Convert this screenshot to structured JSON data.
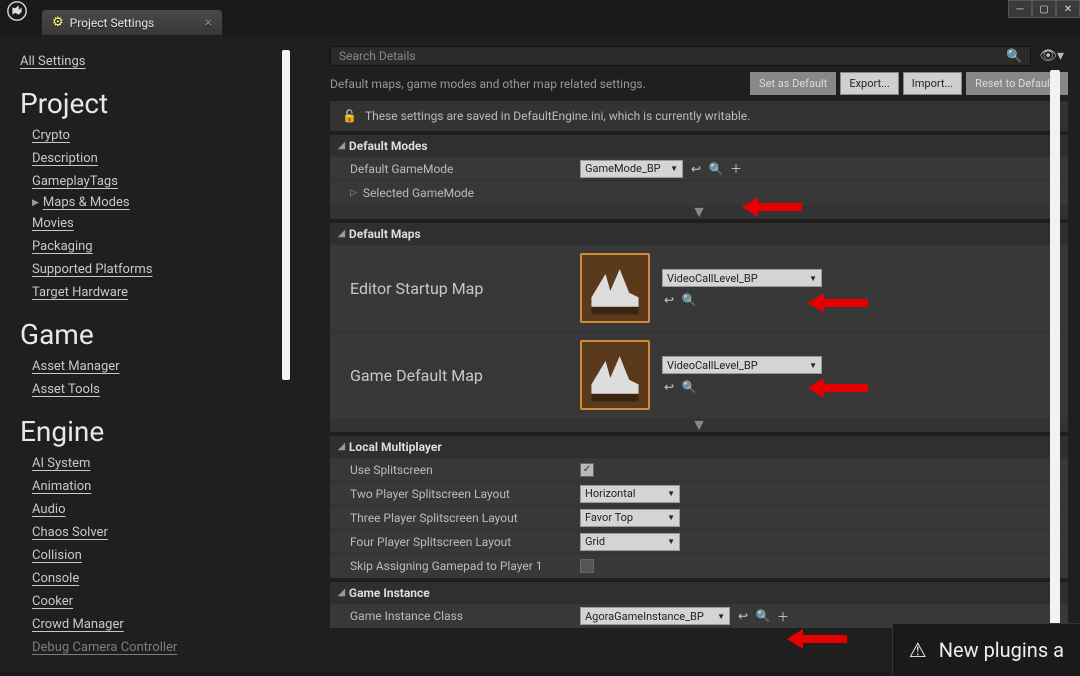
{
  "window": {
    "tab_title": "Project Settings"
  },
  "sidebar": {
    "all": "All Settings",
    "groups": [
      {
        "title": "Project",
        "items": [
          "Crypto",
          "Description",
          "GameplayTags",
          "Maps & Modes",
          "Movies",
          "Packaging",
          "Supported Platforms",
          "Target Hardware"
        ],
        "active_index": 3
      },
      {
        "title": "Game",
        "items": [
          "Asset Manager",
          "Asset Tools"
        ]
      },
      {
        "title": "Engine",
        "items": [
          "AI System",
          "Animation",
          "Audio",
          "Chaos Solver",
          "Collision",
          "Console",
          "Cooker",
          "Crowd Manager",
          "Debug Camera Controller"
        ]
      }
    ]
  },
  "search_placeholder": "Search Details",
  "desc_text": "Default maps, game modes and other map related settings.",
  "buttons": {
    "set_default": "Set as Default",
    "export": "Export...",
    "import": "Import...",
    "reset": "Reset to Defaults"
  },
  "info_text": "These settings are saved in DefaultEngine.ini, which is currently writable.",
  "sections": {
    "default_modes": {
      "title": "Default Modes",
      "game_mode_label": "Default GameMode",
      "game_mode_value": "GameMode_BP",
      "selected_gm": "Selected GameMode"
    },
    "default_maps": {
      "title": "Default Maps",
      "startup_label": "Editor Startup Map",
      "startup_value": "VideoCallLevel_BP",
      "default_label": "Game Default Map",
      "default_value": "VideoCallLevel_BP"
    },
    "local_mp": {
      "title": "Local Multiplayer",
      "splitscreen_label": "Use Splitscreen",
      "two_label": "Two Player Splitscreen Layout",
      "two_value": "Horizontal",
      "three_label": "Three Player Splitscreen Layout",
      "three_value": "Favor Top",
      "four_label": "Four Player Splitscreen Layout",
      "four_value": "Grid",
      "skip_label": "Skip Assigning Gamepad to Player 1"
    },
    "game_instance": {
      "title": "Game Instance",
      "class_label": "Game Instance Class",
      "class_value": "AgoraGameInstance_BP"
    }
  },
  "toast": "New plugins a"
}
